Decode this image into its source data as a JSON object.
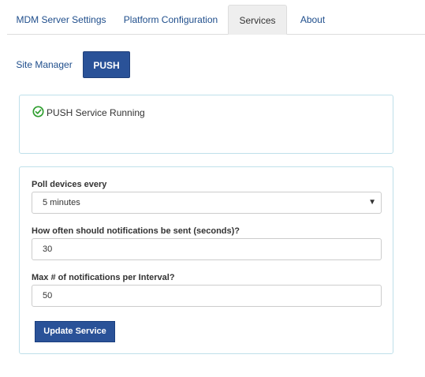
{
  "tabs": [
    {
      "label": "MDM Server Settings"
    },
    {
      "label": "Platform Configuration"
    },
    {
      "label": "Services"
    },
    {
      "label": "About"
    }
  ],
  "subnav": [
    {
      "label": "Site Manager"
    },
    {
      "label": "PUSH"
    }
  ],
  "status": {
    "icon": "check-circle-icon",
    "text": "PUSH Service Running",
    "color": "#2e9e2e"
  },
  "form": {
    "poll_label": "Poll devices every",
    "poll_value": "5 minutes",
    "frequency_label": "How often should notifications be sent (seconds)?",
    "frequency_value": "30",
    "max_label": "Max # of notifications per Interval?",
    "max_value": "50",
    "submit_label": "Update Service"
  },
  "colors": {
    "accent": "#2a5298",
    "panel_border": "#bfe0ea",
    "link": "#1f4e8c"
  }
}
